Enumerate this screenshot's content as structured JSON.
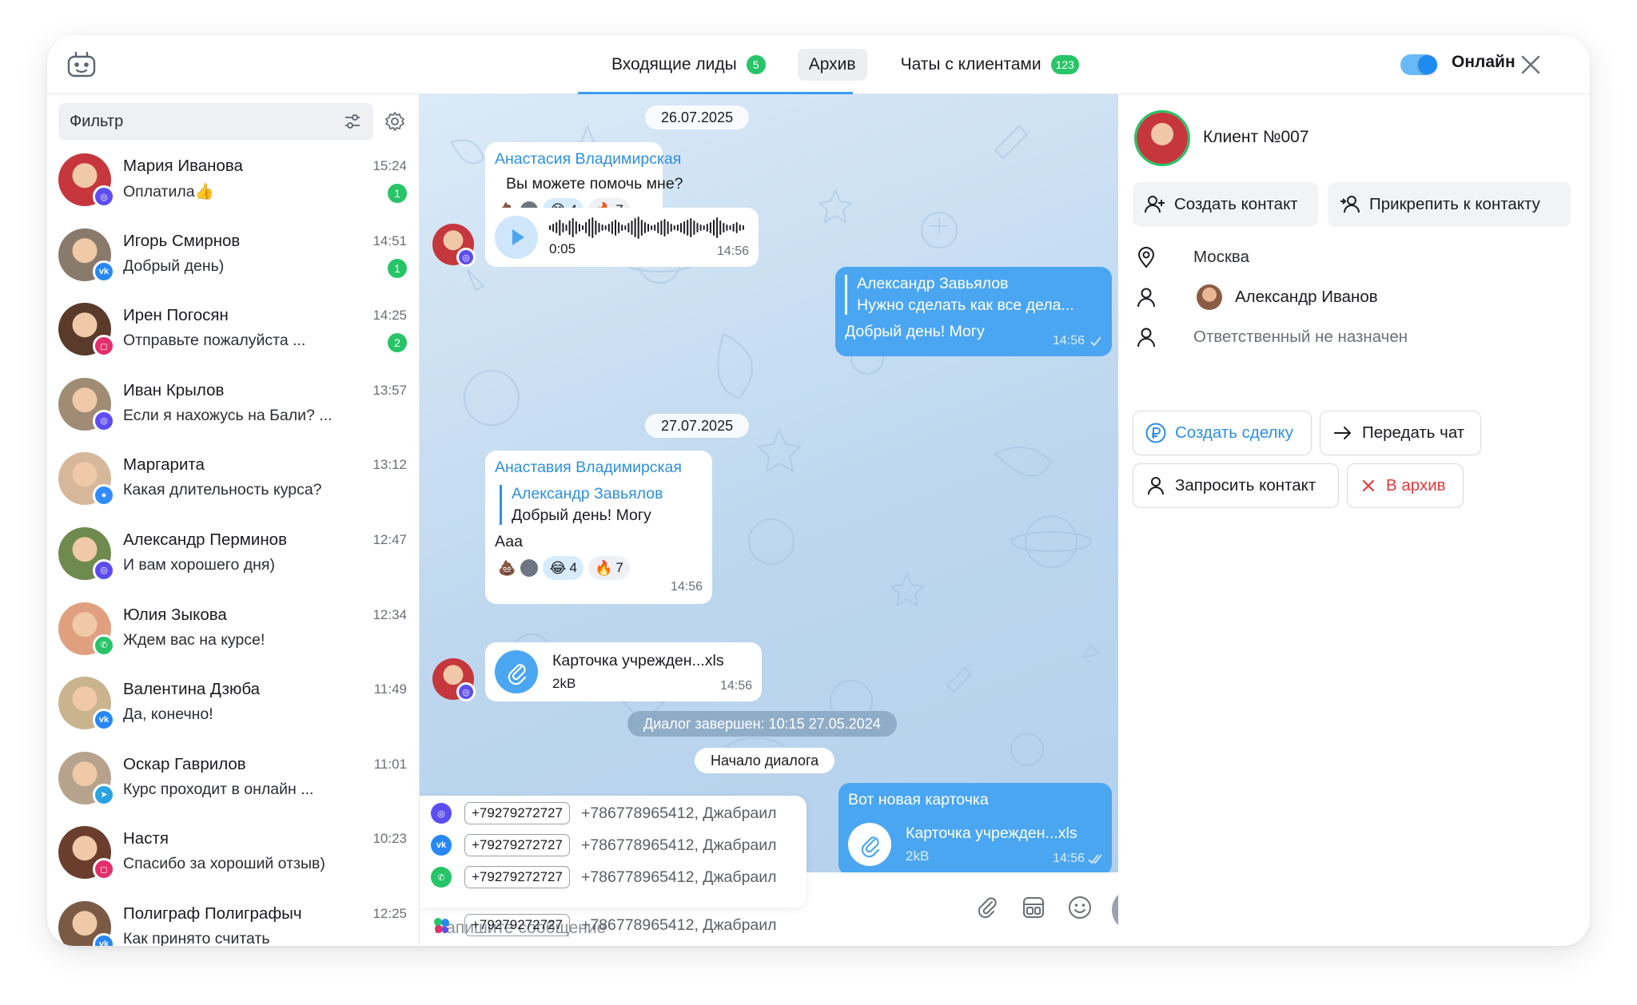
{
  "header": {
    "tabs": [
      {
        "label": "Входящие лиды",
        "badge": "5"
      },
      {
        "label": "Архив"
      },
      {
        "label": "Чаты с клиентами",
        "badge": "123"
      }
    ],
    "online_label": "Онлайн"
  },
  "sidebar": {
    "filter_label": "Фильтр",
    "chats": [
      {
        "name": "Мария Иванова",
        "preview": "Оплатила👍",
        "time": "15:24",
        "unread": "1",
        "source": "messenger",
        "avatar_color": "#c5373d"
      },
      {
        "name": "Игорь Смирнов",
        "preview": "Добрый день)",
        "time": "14:51",
        "unread": "1",
        "source": "vk",
        "avatar_color": "#8a7a6c"
      },
      {
        "name": "Ирен Погосян",
        "preview": "Отправьте пожалуйста ...",
        "time": "14:25",
        "unread": "2",
        "source": "instagram",
        "avatar_color": "#5a3a2a"
      },
      {
        "name": "Иван Крылов",
        "preview": "Если я нахожусь на Бали? ...",
        "time": "13:57",
        "unread": "",
        "source": "messenger",
        "avatar_color": "#a08c74"
      },
      {
        "name": "Маргарита",
        "preview": "Какая длительность курса?",
        "time": "13:12",
        "unread": "",
        "source": "max",
        "avatar_color": "#d6b79a"
      },
      {
        "name": "Александр Перминов",
        "preview": "И вам хорошего дня)",
        "time": "12:47",
        "unread": "",
        "source": "messenger",
        "avatar_color": "#6f8a4e"
      },
      {
        "name": "Юлия Зыкова",
        "preview": "Ждем вас на курсе!",
        "time": "12:34",
        "unread": "",
        "source": "whatsapp",
        "avatar_color": "#e0a080"
      },
      {
        "name": "Валентина Дзюба",
        "preview": "Да, конечно!",
        "time": "11:49",
        "unread": "",
        "source": "vk",
        "avatar_color": "#c9b48f"
      },
      {
        "name": "Оскар Гаврилов",
        "preview": "Курс проходит в онлайн ...",
        "time": "11:01",
        "unread": "",
        "source": "telegram",
        "avatar_color": "#b7a38d"
      },
      {
        "name": "Настя",
        "preview": "Спасибо за хороший отзыв)",
        "time": "10:23",
        "unread": "",
        "source": "instagram",
        "avatar_color": "#6a3d2d"
      },
      {
        "name": "Полиграф Полиграфыч",
        "preview": "Как принято считать",
        "time": "12:25",
        "unread": "",
        "source": "vk",
        "avatar_color": "#7a5a44"
      }
    ]
  },
  "chat": {
    "date1": "26.07.2025",
    "msg1": {
      "author": "Анастасия Владимирская",
      "text": "Вы можете помочь мне?",
      "reaction_count_1": "4",
      "reaction_count_2": "7"
    },
    "voice": {
      "duration": "0:05",
      "time": "14:56"
    },
    "out1": {
      "reply_author": "Александр Завьялов",
      "reply_text": "Нужно сделать как все дела...",
      "text": "Добрый день! Могу",
      "time": "14:56"
    },
    "date2": "27.07.2025",
    "msg2": {
      "author": "Анаставия Владимирская",
      "reply_author": "Александр Завьялов",
      "reply_text": "Добрый день! Могу",
      "text": "Ааа",
      "reaction_count_1": "4",
      "reaction_count_2": "7",
      "time": "14:56"
    },
    "file1": {
      "name": "Карточка учрежден...xls",
      "size": "2kB",
      "time": "14:56"
    },
    "dialog_ended": "Диалог завершен: 10:15 27.05.2024",
    "dialog_start": "Начало диалога",
    "out2": {
      "text": "Вот новая карточка",
      "file_name": "Карточка учрежден...xls",
      "file_size": "2kB",
      "time": "14:56"
    },
    "suggestions": [
      {
        "source": "messenger",
        "phone": "+79279272727",
        "text": "+786778965412, Джабраил"
      },
      {
        "source": "vk",
        "phone": "+79279272727",
        "text": "+786778965412, Джабраил"
      },
      {
        "source": "whatsapp",
        "phone": "+79279272727",
        "text": "+786778965412, Джабраил"
      },
      {
        "source": "multi",
        "phone": "+79279272727",
        "text": "+786778965412, Джабраил"
      }
    ],
    "input_placeholder": "Напишите сообщение"
  },
  "panel": {
    "client_name": "Клиент №007",
    "btn_create_contact": "Создать контакт",
    "btn_attach_contact": "Прикрепить к контакту",
    "city": "Москва",
    "manager": "Александр Иванов",
    "responsible": "Ответственный не назначен",
    "btn_create_deal": "Создать сделку",
    "btn_transfer": "Передать чат",
    "btn_request_contact": "Запросить контакт",
    "btn_archive": "В архив"
  },
  "colors": {
    "accent": "#3d9bf2",
    "green": "#27c468",
    "danger": "#e5383b",
    "bubble_out": "#4ba6f2"
  }
}
